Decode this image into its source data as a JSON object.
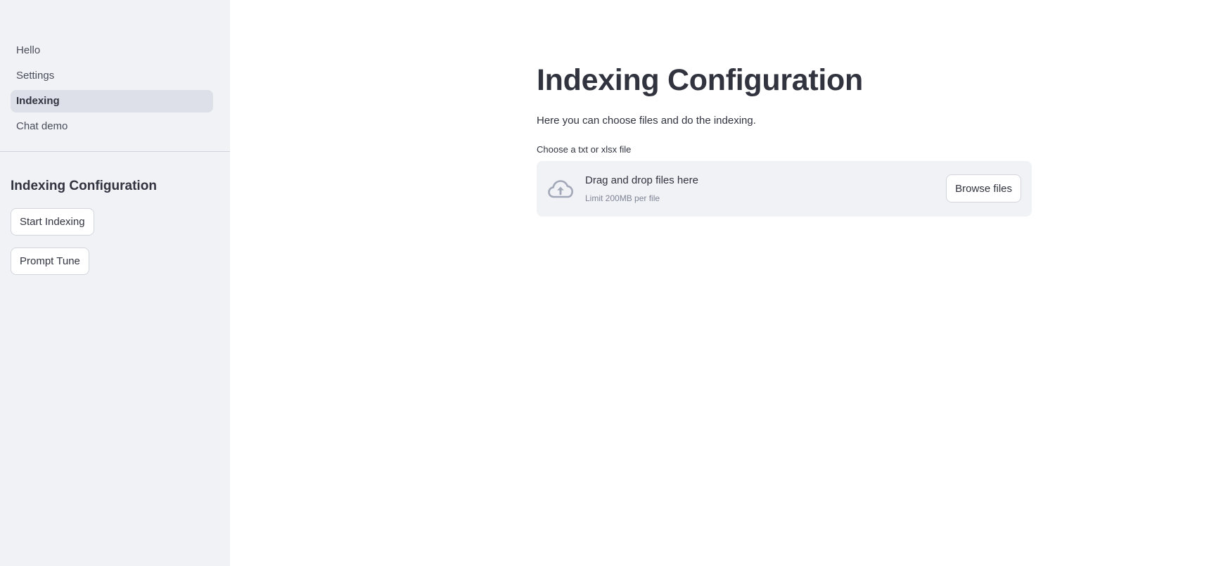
{
  "sidebar": {
    "nav_items": [
      {
        "label": "Hello",
        "active": false
      },
      {
        "label": "Settings",
        "active": false
      },
      {
        "label": "Indexing",
        "active": true
      },
      {
        "label": "Chat demo",
        "active": false
      }
    ],
    "section_heading": "Indexing Configuration",
    "start_indexing_label": "Start Indexing",
    "prompt_tune_label": "Prompt Tune"
  },
  "main": {
    "title": "Indexing Configuration",
    "description": "Here you can choose files and do the indexing.",
    "uploader": {
      "label": "Choose a txt or xlsx file",
      "drop_text": "Drag and drop files here",
      "limit_text": "Limit 200MB per file",
      "browse_label": "Browse files",
      "icon": "cloud-upload-icon"
    }
  },
  "colors": {
    "sidebar_bg": "#f0f2f6",
    "active_nav_bg": "#dde0e9",
    "text": "#31333f",
    "muted_text": "#808495",
    "icon": "#a3a8b8"
  }
}
